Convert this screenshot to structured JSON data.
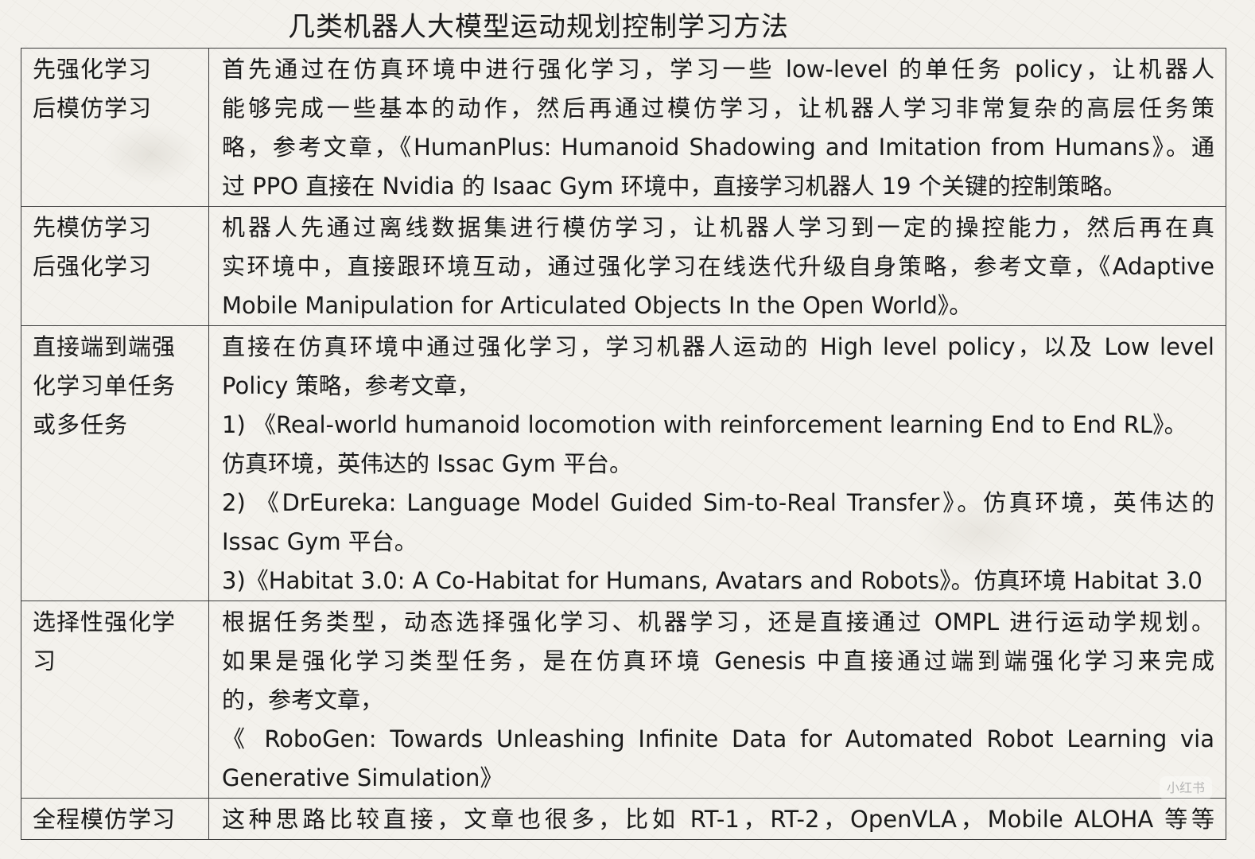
{
  "title": "几类机器人大模型运动规划控制学习方法",
  "rows": [
    {
      "name_lines": [
        "先强化学习",
        "后模仿学习"
      ],
      "desc_lines": [
        "首先通过在仿真环境中进行强化学习，学习一些 low-level 的单任务 policy，让机器人",
        "能够完成一些基本的动作，然后再通过模仿学习，让机器人学习非常复杂的高层任务策",
        "略，参考文章，《HumanPlus: Humanoid Shadowing and Imitation from Humans》。通",
        "过 PPO 直接在 Nvidia 的 Isaac Gym 环境中，直接学习机器人 19 个关键的控制策略。"
      ]
    },
    {
      "name_lines": [
        "先模仿学习",
        "后强化学习"
      ],
      "desc_lines": [
        "机器人先通过离线数据集进行模仿学习，让机器人学习到一定的操控能力，然后再在真",
        "实环境中，直接跟环境互动，通过强化学习在线迭代升级自身策略，参考文章，《Adaptive",
        "Mobile Manipulation for Articulated Objects In the Open World》。"
      ]
    },
    {
      "name_lines": [
        "直接端到端强",
        "化学习单任务",
        "或多任务"
      ],
      "desc_lines": [
        "直接在仿真环境中通过强化学习，学习机器人运动的 High level policy，以及 Low level",
        "Policy 策略，参考文章，",
        "1) 《Real-world humanoid locomotion with reinforcement learning End to End RL》。",
        "仿真环境，英伟达的 Issac Gym 平台。",
        "2) 《DrEureka: Language Model Guided Sim-to-Real Transfer》。仿真环境，英伟达的",
        "Issac Gym 平台。",
        "3)《Habitat 3.0: A Co-Habitat for Humans, Avatars and Robots》。仿真环境 Habitat 3.0"
      ]
    },
    {
      "name_lines": [
        "选择性强化学",
        "习"
      ],
      "desc_lines": [
        "根据任务类型，动态选择强化学习、机器学习，还是直接通过 OMPL 进行运动学规划。",
        "如果是强化学习类型任务，是在仿真环境 Genesis 中直接通过端到端强化学习来完成",
        "的，参考文章，",
        "《 RoboGen: Towards Unleashing Infinite Data for Automated Robot Learning via",
        "Generative Simulation》"
      ]
    },
    {
      "name_lines": [
        "全程模仿学习"
      ],
      "desc_lines": [
        "这种思路比较直接，文章也很多，比如 RT-1，RT-2，OpenVLA，Mobile ALOHA 等等"
      ]
    }
  ],
  "watermark": "小红书"
}
